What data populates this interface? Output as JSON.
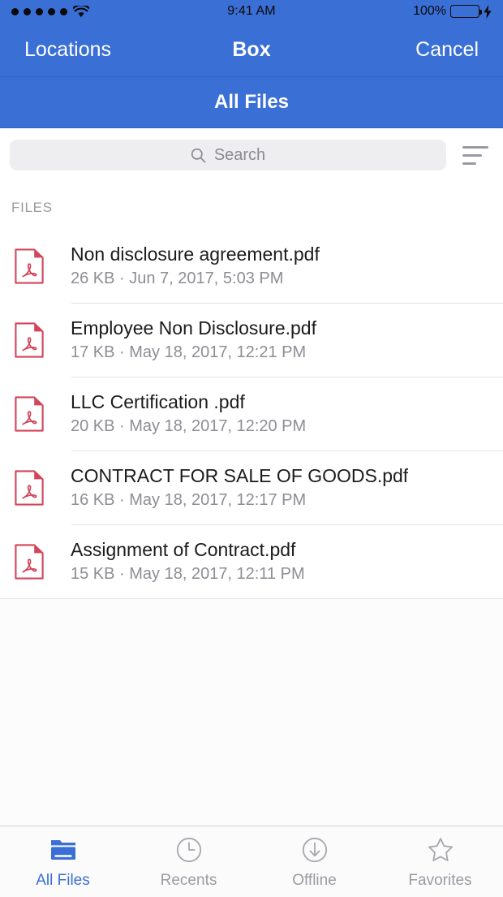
{
  "status_bar": {
    "signal_dots": 5,
    "wifi_icon": "wifi-icon",
    "time": "9:41 AM",
    "battery_percent": "100%",
    "battery_icon": "battery-full-icon",
    "charging_icon": "lightning-bolt-icon"
  },
  "nav_bar": {
    "back_label": "Locations",
    "title": "Box",
    "cancel_label": "Cancel"
  },
  "sub_header": {
    "title": "All Files"
  },
  "search": {
    "placeholder": "Search",
    "value": "",
    "icon": "search-icon",
    "sort_icon": "sort-lines-icon"
  },
  "section": {
    "label": "FILES"
  },
  "files": [
    {
      "icon": "pdf-file-icon",
      "name": "Non disclosure agreement.pdf",
      "size": "26 KB",
      "separator": "·",
      "modified": "Jun 7, 2017, 5:03 PM",
      "meta": "26 KB · Jun 7, 2017, 5:03 PM"
    },
    {
      "icon": "pdf-file-icon",
      "name": "Employee Non Disclosure.pdf",
      "size": "17 KB",
      "separator": "·",
      "modified": "May 18, 2017, 12:21 PM",
      "meta": "17 KB · May 18, 2017, 12:21 PM"
    },
    {
      "icon": "pdf-file-icon",
      "name": "LLC Certification .pdf",
      "size": "20 KB",
      "separator": "·",
      "modified": "May 18, 2017, 12:20 PM",
      "meta": "20 KB · May 18, 2017, 12:20 PM"
    },
    {
      "icon": "pdf-file-icon",
      "name": "CONTRACT FOR SALE OF GOODS.pdf",
      "size": "16 KB",
      "separator": "·",
      "modified": "May 18, 2017, 12:17 PM",
      "meta": "16 KB · May 18, 2017, 12:17 PM"
    },
    {
      "icon": "pdf-file-icon",
      "name": "Assignment of Contract.pdf",
      "size": "15 KB",
      "separator": "·",
      "modified": "May 18, 2017, 12:11 PM",
      "meta": "15 KB · May 18, 2017, 12:11 PM"
    }
  ],
  "tab_bar": {
    "tabs": [
      {
        "label": "All Files",
        "icon": "folder-icon",
        "active": true
      },
      {
        "label": "Recents",
        "icon": "clock-icon",
        "active": false
      },
      {
        "label": "Offline",
        "icon": "download-arrow-icon",
        "active": false
      },
      {
        "label": "Favorites",
        "icon": "star-icon",
        "active": false
      }
    ]
  },
  "colors": {
    "brand_blue": "#3a6fd6",
    "nav_divider": "#3263c2",
    "pdf_red": "#d2455a",
    "search_fill": "#eeeef0",
    "muted_text": "#8d8d95",
    "battery_green": "#8ae084",
    "separator": "#e6e6ea"
  }
}
